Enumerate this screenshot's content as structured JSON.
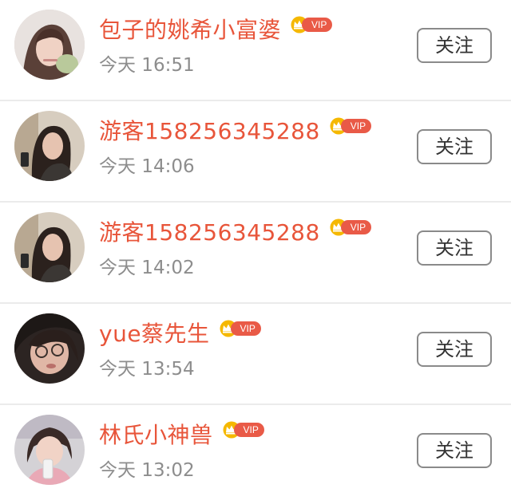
{
  "colors": {
    "name": "#e8553a",
    "time": "#8d8d8d",
    "vip_badge": "#e95a47",
    "crown": "#f5b800",
    "divider": "#ebebeb",
    "button_border": "#8a8a8a"
  },
  "vip_label": "VIP",
  "follow_label": "关注",
  "users": [
    {
      "name": "包子的姚希小富婆",
      "time": "今天 16:51",
      "avatar_icon": "avatar-user-1"
    },
    {
      "name": "游客158256345288",
      "time": "今天 14:06",
      "avatar_icon": "avatar-user-2"
    },
    {
      "name": "游客158256345288",
      "time": "今天 14:02",
      "avatar_icon": "avatar-user-3"
    },
    {
      "name": "yue蔡先生",
      "time": "今天 13:54",
      "avatar_icon": "avatar-user-4"
    },
    {
      "name": "林氏小神兽",
      "time": "今天 13:02",
      "avatar_icon": "avatar-user-5"
    }
  ]
}
